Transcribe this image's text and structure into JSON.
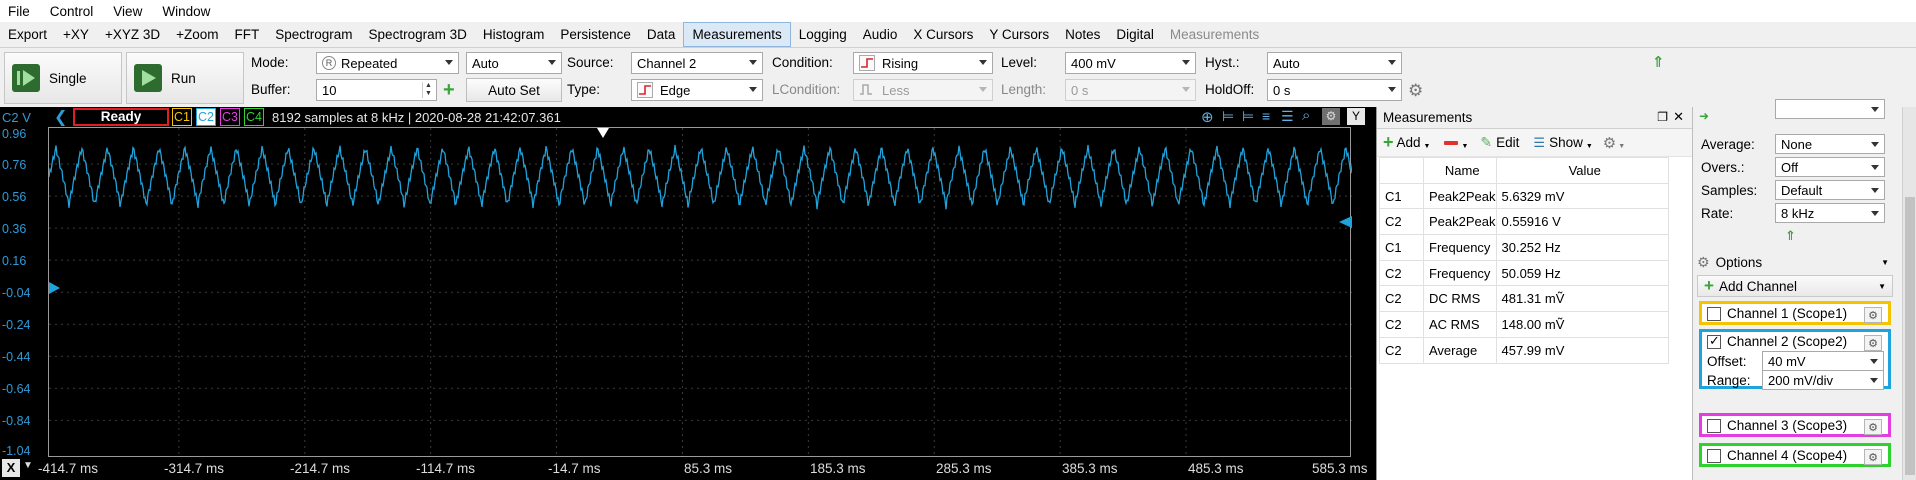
{
  "menu": [
    "File",
    "Control",
    "View",
    "Window"
  ],
  "tabs": [
    {
      "label": "Export"
    },
    {
      "label": "+XY"
    },
    {
      "label": "+XYZ 3D"
    },
    {
      "label": "+Zoom"
    },
    {
      "label": "FFT"
    },
    {
      "label": "Spectrogram"
    },
    {
      "label": "Spectrogram 3D"
    },
    {
      "label": "Histogram"
    },
    {
      "label": "Persistence"
    },
    {
      "label": "Data"
    },
    {
      "label": "Measurements"
    },
    {
      "label": "Logging"
    },
    {
      "label": "Audio"
    },
    {
      "label": "X Cursors"
    },
    {
      "label": "Y Cursors"
    },
    {
      "label": "Notes"
    },
    {
      "label": "Digital"
    },
    {
      "label": "Measurements"
    }
  ],
  "toolbar": {
    "single_label": "Single",
    "run_label": "Run",
    "mode_label": "Mode:",
    "mode_value": "Repeated",
    "auto_value": "Auto",
    "buffer_label": "Buffer:",
    "buffer_value": "10",
    "autoset_label": "Auto Set",
    "source_label": "Source:",
    "source_value": "Channel 2",
    "type_label": "Type:",
    "type_value": "Edge",
    "condition_label": "Condition:",
    "condition_value": "Rising",
    "lcondition_label": "LCondition:",
    "lcondition_value": "Less",
    "level_label": "Level:",
    "level_value": "400 mV",
    "length_label": "Length:",
    "length_value": "0 s",
    "hyst_label": "Hyst.:",
    "hyst_value": "Auto",
    "holdoff_label": "HoldOff:",
    "holdoff_value": "0 s"
  },
  "scope": {
    "axis_label": "C2 V",
    "status": "Ready",
    "channels": [
      "C1",
      "C2",
      "C3",
      "C4"
    ],
    "info": "8192 samples at 8 kHz | 2020-08-28 21:42:07.361",
    "y_ticks": [
      "0.96",
      "0.76",
      "0.56",
      "0.36",
      "0.16",
      "-0.04",
      "-0.24",
      "-0.44",
      "-0.64",
      "-0.84",
      "-1.04"
    ],
    "x_close": "X",
    "x_ticks": [
      "-414.7 ms",
      "-314.7 ms",
      "-214.7 ms",
      "-114.7 ms",
      "-14.7 ms",
      "85.3 ms",
      "185.3 ms",
      "285.3 ms",
      "385.3 ms",
      "485.3 ms",
      "585.3 ms"
    ],
    "colors": {
      "c1": "#f5c400",
      "c2": "#1fa3dc",
      "c3": "#e23ee0",
      "c4": "#2fd12f",
      "status_border": "#e02020"
    }
  },
  "measurements": {
    "title": "Measurements",
    "add_label": "Add",
    "edit_label": "Edit",
    "show_label": "Show",
    "col_name": "Name",
    "col_value": "Value",
    "rows": [
      {
        "ch": "C1",
        "name": "Peak2Peak",
        "value": "5.6329 mV"
      },
      {
        "ch": "C2",
        "name": "Peak2Peak",
        "value": "0.55916 V"
      },
      {
        "ch": "C1",
        "name": "Frequency",
        "value": "30.252 Hz"
      },
      {
        "ch": "C2",
        "name": "Frequency",
        "value": "50.059 Hz"
      },
      {
        "ch": "C2",
        "name": "DC RMS",
        "value": "481.31 mṼ"
      },
      {
        "ch": "C2",
        "name": "AC RMS",
        "value": "148.00 mṼ"
      },
      {
        "ch": "C2",
        "name": "Average",
        "value": "457.99 mV"
      }
    ]
  },
  "side": {
    "average_label": "Average:",
    "average_value": "None",
    "overs_label": "Overs.:",
    "overs_value": "Off",
    "samples_label": "Samples:",
    "samples_value": "Default",
    "rate_label": "Rate:",
    "rate_value": "8 kHz",
    "options_label": "Options",
    "add_channel_label": "Add Channel",
    "channel1": "Channel 1 (Scope1)",
    "channel2": "Channel 2 (Scope2)",
    "offset_label": "Offset:",
    "offset_value": "40 mV",
    "range_label": "Range:",
    "range_value": "200 mV/div",
    "channel3": "Channel 3 (Scope3)",
    "channel4": "Channel 4 (Scope4)"
  }
}
